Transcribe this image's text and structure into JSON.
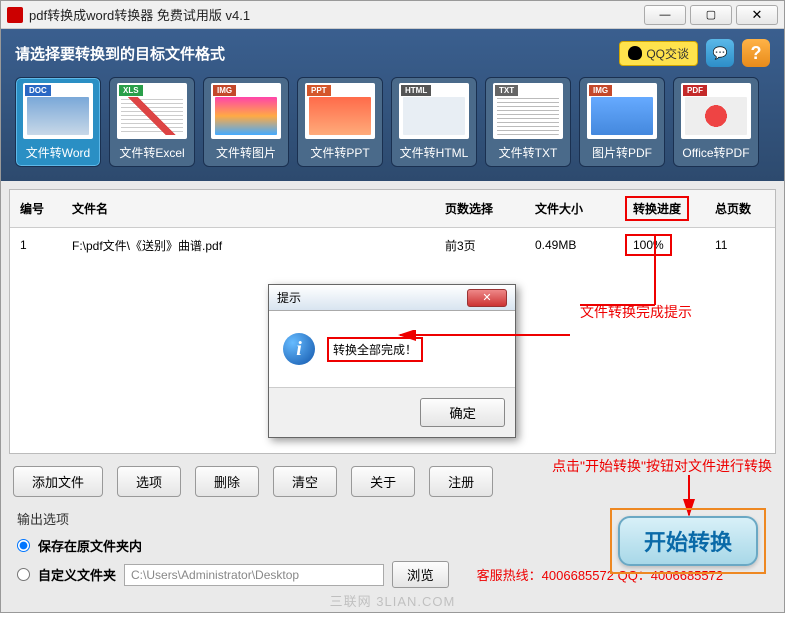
{
  "title": "pdf转换成word转换器 免费试用版 v4.1",
  "header": {
    "prompt": "请选择要转换到的目标文件格式",
    "qq_label": "QQ交谈"
  },
  "formats": [
    {
      "tag": "DOC",
      "label": "文件转Word"
    },
    {
      "tag": "XLS",
      "label": "文件转Excel"
    },
    {
      "tag": "IMG",
      "label": "文件转图片"
    },
    {
      "tag": "PPT",
      "label": "文件转PPT"
    },
    {
      "tag": "HTML",
      "label": "文件转HTML"
    },
    {
      "tag": "TXT",
      "label": "文件转TXT"
    },
    {
      "tag": "IMG",
      "label": "图片转PDF"
    },
    {
      "tag": "PDF",
      "label": "Office转PDF"
    }
  ],
  "table": {
    "headers": {
      "no": "编号",
      "name": "文件名",
      "pages": "页数选择",
      "size": "文件大小",
      "progress": "转换进度",
      "total": "总页数"
    },
    "rows": [
      {
        "no": "1",
        "name": "F:\\pdf文件\\《送别》曲谱.pdf",
        "pages": "前3页",
        "size": "0.49MB",
        "progress": "100%",
        "total": "11"
      }
    ]
  },
  "dialog": {
    "title": "提示",
    "message": "转换全部完成！",
    "ok": "确定"
  },
  "annotations": {
    "complete_tip": "文件转换完成提示",
    "start_tip": "点击\"开始转换\"按钮对文件进行转换"
  },
  "buttons": {
    "add": "添加文件",
    "select": "选项",
    "delete": "删除",
    "clear": "清空",
    "about": "关于",
    "register": "注册",
    "start": "开始转换",
    "browse": "浏览"
  },
  "output": {
    "title": "输出选项",
    "opt1": "保存在原文件夹内",
    "opt2": "自定义文件夹",
    "path": "C:\\Users\\Administrator\\Desktop"
  },
  "hotline": "客服热线：4006685572 QQ：4006685572",
  "watermark": "三联网 3LIAN.COM"
}
